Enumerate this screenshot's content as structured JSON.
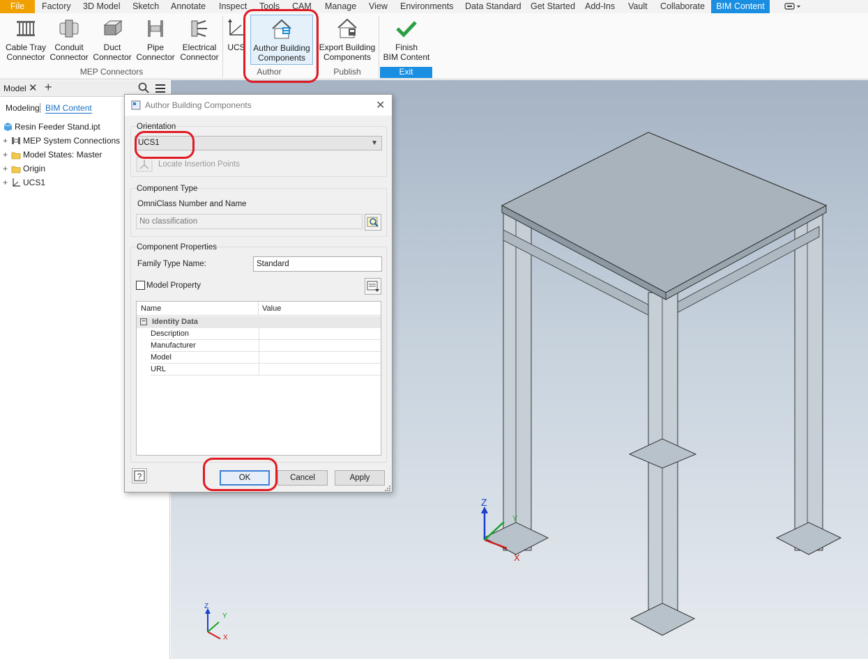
{
  "menu": {
    "items": [
      "File",
      "Factory",
      "3D Model",
      "Sketch",
      "Annotate",
      "Inspect",
      "Tools",
      "CAM",
      "Manage",
      "View",
      "Environments",
      "Data Standard",
      "Get Started",
      "Add-Ins",
      "Vault",
      "Collaborate",
      "BIM Content"
    ],
    "active": "BIM Content"
  },
  "ribbon": {
    "cable_tray": "Cable Tray\nConnector",
    "conduit": "Conduit\nConnector",
    "duct": "Duct\nConnector",
    "pipe": "Pipe\nConnector",
    "electrical": "Electrical\nConnector",
    "ucs": "UCS",
    "author_building": "Author Building\nComponents",
    "export_building": "Export Building\nComponents",
    "finish_bim": "Finish\nBIM Content",
    "groups": {
      "mep": "MEP Connectors",
      "author": "Author",
      "publish": "Publish",
      "exit": "Exit"
    }
  },
  "browser": {
    "tab_label": "Model",
    "subtab_modeling": "Modeling",
    "subtab_bim": "BIM Content",
    "tree": {
      "root": "Resin Feeder Stand.ipt",
      "mep": "MEP System Connections",
      "model_states": "Model States: Master",
      "origin": "Origin",
      "ucs1": "UCS1"
    }
  },
  "dialog": {
    "title": "Author Building Components",
    "orientation_legend": "Orientation",
    "orientation_value": "UCS1",
    "locate_insertion": "Locate Insertion Points",
    "component_type_legend": "Component Type",
    "omniclass_label": "OmniClass Number and Name",
    "omniclass_value": "No classification",
    "component_props_legend": "Component Properties",
    "family_type_label": "Family Type Name:",
    "family_type_value": "Standard",
    "model_property_label": "Model Property",
    "grid": {
      "col_name": "Name",
      "col_value": "Value",
      "group": "Identity Data",
      "rows": [
        "Description",
        "Manufacturer",
        "Model",
        "URL"
      ]
    },
    "ok": "OK",
    "cancel": "Cancel",
    "apply": "Apply"
  },
  "viewport": {
    "axis_z": "Z",
    "axis_y": "Y",
    "axis_x": "X"
  },
  "colors": {
    "accent": "#1a8ee0",
    "file": "#f0a000",
    "annotation": "#e01b24",
    "check": "#2aa043"
  }
}
